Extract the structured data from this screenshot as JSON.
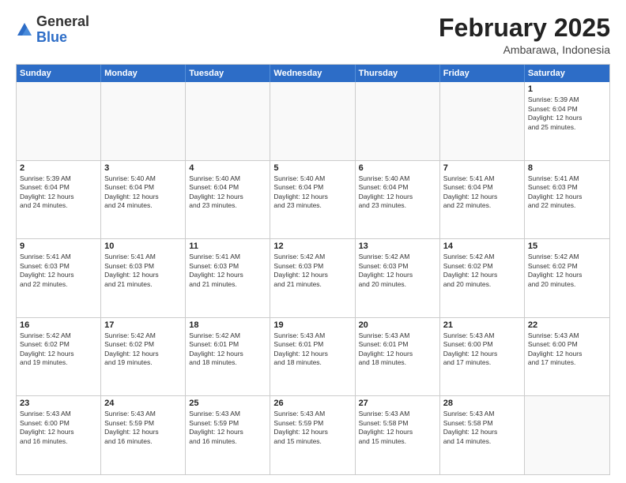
{
  "logo": {
    "general": "General",
    "blue": "Blue"
  },
  "header": {
    "title": "February 2025",
    "subtitle": "Ambarawa, Indonesia"
  },
  "days": [
    "Sunday",
    "Monday",
    "Tuesday",
    "Wednesday",
    "Thursday",
    "Friday",
    "Saturday"
  ],
  "weeks": [
    [
      {
        "day": "",
        "text": ""
      },
      {
        "day": "",
        "text": ""
      },
      {
        "day": "",
        "text": ""
      },
      {
        "day": "",
        "text": ""
      },
      {
        "day": "",
        "text": ""
      },
      {
        "day": "",
        "text": ""
      },
      {
        "day": "1",
        "text": "Sunrise: 5:39 AM\nSunset: 6:04 PM\nDaylight: 12 hours\nand 25 minutes."
      }
    ],
    [
      {
        "day": "2",
        "text": "Sunrise: 5:39 AM\nSunset: 6:04 PM\nDaylight: 12 hours\nand 24 minutes."
      },
      {
        "day": "3",
        "text": "Sunrise: 5:40 AM\nSunset: 6:04 PM\nDaylight: 12 hours\nand 24 minutes."
      },
      {
        "day": "4",
        "text": "Sunrise: 5:40 AM\nSunset: 6:04 PM\nDaylight: 12 hours\nand 23 minutes."
      },
      {
        "day": "5",
        "text": "Sunrise: 5:40 AM\nSunset: 6:04 PM\nDaylight: 12 hours\nand 23 minutes."
      },
      {
        "day": "6",
        "text": "Sunrise: 5:40 AM\nSunset: 6:04 PM\nDaylight: 12 hours\nand 23 minutes."
      },
      {
        "day": "7",
        "text": "Sunrise: 5:41 AM\nSunset: 6:04 PM\nDaylight: 12 hours\nand 22 minutes."
      },
      {
        "day": "8",
        "text": "Sunrise: 5:41 AM\nSunset: 6:03 PM\nDaylight: 12 hours\nand 22 minutes."
      }
    ],
    [
      {
        "day": "9",
        "text": "Sunrise: 5:41 AM\nSunset: 6:03 PM\nDaylight: 12 hours\nand 22 minutes."
      },
      {
        "day": "10",
        "text": "Sunrise: 5:41 AM\nSunset: 6:03 PM\nDaylight: 12 hours\nand 21 minutes."
      },
      {
        "day": "11",
        "text": "Sunrise: 5:41 AM\nSunset: 6:03 PM\nDaylight: 12 hours\nand 21 minutes."
      },
      {
        "day": "12",
        "text": "Sunrise: 5:42 AM\nSunset: 6:03 PM\nDaylight: 12 hours\nand 21 minutes."
      },
      {
        "day": "13",
        "text": "Sunrise: 5:42 AM\nSunset: 6:03 PM\nDaylight: 12 hours\nand 20 minutes."
      },
      {
        "day": "14",
        "text": "Sunrise: 5:42 AM\nSunset: 6:02 PM\nDaylight: 12 hours\nand 20 minutes."
      },
      {
        "day": "15",
        "text": "Sunrise: 5:42 AM\nSunset: 6:02 PM\nDaylight: 12 hours\nand 20 minutes."
      }
    ],
    [
      {
        "day": "16",
        "text": "Sunrise: 5:42 AM\nSunset: 6:02 PM\nDaylight: 12 hours\nand 19 minutes."
      },
      {
        "day": "17",
        "text": "Sunrise: 5:42 AM\nSunset: 6:02 PM\nDaylight: 12 hours\nand 19 minutes."
      },
      {
        "day": "18",
        "text": "Sunrise: 5:42 AM\nSunset: 6:01 PM\nDaylight: 12 hours\nand 18 minutes."
      },
      {
        "day": "19",
        "text": "Sunrise: 5:43 AM\nSunset: 6:01 PM\nDaylight: 12 hours\nand 18 minutes."
      },
      {
        "day": "20",
        "text": "Sunrise: 5:43 AM\nSunset: 6:01 PM\nDaylight: 12 hours\nand 18 minutes."
      },
      {
        "day": "21",
        "text": "Sunrise: 5:43 AM\nSunset: 6:00 PM\nDaylight: 12 hours\nand 17 minutes."
      },
      {
        "day": "22",
        "text": "Sunrise: 5:43 AM\nSunset: 6:00 PM\nDaylight: 12 hours\nand 17 minutes."
      }
    ],
    [
      {
        "day": "23",
        "text": "Sunrise: 5:43 AM\nSunset: 6:00 PM\nDaylight: 12 hours\nand 16 minutes."
      },
      {
        "day": "24",
        "text": "Sunrise: 5:43 AM\nSunset: 5:59 PM\nDaylight: 12 hours\nand 16 minutes."
      },
      {
        "day": "25",
        "text": "Sunrise: 5:43 AM\nSunset: 5:59 PM\nDaylight: 12 hours\nand 16 minutes."
      },
      {
        "day": "26",
        "text": "Sunrise: 5:43 AM\nSunset: 5:59 PM\nDaylight: 12 hours\nand 15 minutes."
      },
      {
        "day": "27",
        "text": "Sunrise: 5:43 AM\nSunset: 5:58 PM\nDaylight: 12 hours\nand 15 minutes."
      },
      {
        "day": "28",
        "text": "Sunrise: 5:43 AM\nSunset: 5:58 PM\nDaylight: 12 hours\nand 14 minutes."
      },
      {
        "day": "",
        "text": ""
      }
    ]
  ]
}
